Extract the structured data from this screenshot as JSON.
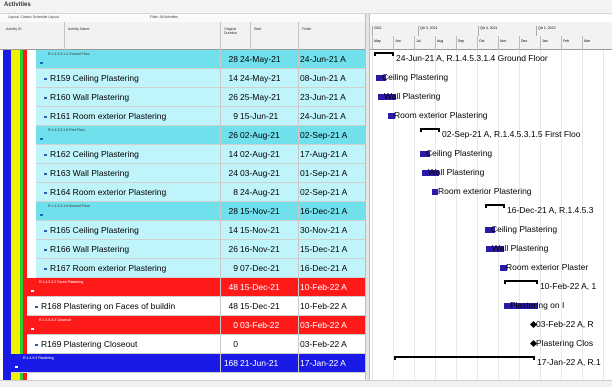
{
  "window": {
    "title": "Activities"
  },
  "toolbar": {
    "left": "Layout: Classic Schedule Layout",
    "filter": "Filter: All Activities"
  },
  "columns": {
    "activity_id": "Activity ID",
    "activity_name": "Activity Name",
    "original_duration": "Original Duration",
    "start": "Start",
    "finish": "Finish"
  },
  "timescale": {
    "years": [
      "2021",
      "Qtr 3, 2021",
      "Qtr 4, 2021",
      "Qtr 1, 2022"
    ],
    "months": [
      "May",
      "Jun",
      "Jul",
      "Aug",
      "Sep",
      "Oct",
      "Nov",
      "Dec",
      "Jan",
      "Feb",
      "Mar"
    ]
  },
  "rows": [
    {
      "type": "wbs",
      "color": "#70e0ec",
      "code": "R.1.4.5.3.1.4 Ground Floor",
      "name": "",
      "dur": "28",
      "start": "24-May-21 A",
      "finish": "24-Jun-21 A"
    },
    {
      "type": "task",
      "color": "#bff4fa",
      "code": "",
      "name": "R159  Ceiling Plastering",
      "dur": "14",
      "start": "24-May-21 A",
      "finish": "08-Jun-21 A"
    },
    {
      "type": "task",
      "color": "#bff4fa",
      "code": "",
      "name": "R160  Wall Plastering",
      "dur": "26",
      "start": "25-May-21 A",
      "finish": "23-Jun-21 A"
    },
    {
      "type": "task",
      "color": "#bff4fa",
      "code": "",
      "name": "R161  Room exterior Plastering",
      "dur": "9",
      "start": "15-Jun-21 A",
      "finish": "24-Jun-21 A"
    },
    {
      "type": "wbs",
      "color": "#70e0ec",
      "code": "R.1.4.5.3.1.5 First Floor",
      "name": "",
      "dur": "26",
      "start": "02-Aug-21 A",
      "finish": "02-Sep-21 A"
    },
    {
      "type": "task",
      "color": "#bff4fa",
      "code": "",
      "name": "R162  Ceiling Plastering",
      "dur": "14",
      "start": "02-Aug-21 A",
      "finish": "17-Aug-21 A"
    },
    {
      "type": "task",
      "color": "#bff4fa",
      "code": "",
      "name": "R163  Wall Plastering",
      "dur": "24",
      "start": "03-Aug-21 A",
      "finish": "01-Sep-21 A"
    },
    {
      "type": "task",
      "color": "#bff4fa",
      "code": "",
      "name": "R164  Room exterior Plastering",
      "dur": "8",
      "start": "24-Aug-21 A",
      "finish": "02-Sep-21 A"
    },
    {
      "type": "wbs",
      "color": "#70e0ec",
      "code": "R.1.4.5.3.1.6 Second Floor",
      "name": "",
      "dur": "28",
      "start": "15-Nov-21 A",
      "finish": "16-Dec-21 A"
    },
    {
      "type": "task",
      "color": "#bff4fa",
      "code": "",
      "name": "R165  Ceiling Plastering",
      "dur": "14",
      "start": "15-Nov-21 A",
      "finish": "30-Nov-21 A"
    },
    {
      "type": "task",
      "color": "#bff4fa",
      "code": "",
      "name": "R166  Wall Plastering",
      "dur": "26",
      "start": "16-Nov-21 A",
      "finish": "15-Dec-21 A"
    },
    {
      "type": "task",
      "color": "#bff4fa",
      "code": "",
      "name": "R167  Room exterior Plastering",
      "dur": "9",
      "start": "07-Dec-21 A",
      "finish": "16-Dec-21 A"
    },
    {
      "type": "wbs2",
      "color": "#ff1a1a",
      "code": "R.1.4.5.3.2 Faces Plastering",
      "name": "",
      "dur": "48",
      "start": "15-Dec-21 A",
      "finish": "10-Feb-22 A"
    },
    {
      "type": "task",
      "color": "#ffffff",
      "code": "",
      "name": "R168  Plastering on Faces of buildin",
      "dur": "48",
      "start": "15-Dec-21 A",
      "finish": "10-Feb-22 A"
    },
    {
      "type": "wbs2",
      "color": "#ff1a1a",
      "code": "R.1.4.5.3.3 Closeout",
      "name": "",
      "dur": "0",
      "start": "03-Feb-22 A",
      "finish": "03-Feb-22 A"
    },
    {
      "type": "task",
      "color": "#ffffff",
      "code": "",
      "name": "R169  Plastering Closeout",
      "dur": "0",
      "start": "",
      "finish": "03-Feb-22 A"
    },
    {
      "type": "wbs3",
      "color": "#1a1ae6",
      "code": "R.1.4.5.3 Plastering",
      "name": "",
      "dur": "168",
      "start": "21-Jun-21 A",
      "finish": "17-Jan-22 A"
    }
  ],
  "gantt_labels": [
    "24-Jun-21 A, R.1.4.5.3.1.4  Ground Floor",
    "Ceiling Plastering",
    "Wall Plastering",
    "Room exterior Plastering",
    "02-Sep-21 A, R.1.4.5.3.1.5  First Floo",
    "Ceiling Plastering",
    "Wall Plastering",
    "Room exterior Plastering",
    "16-Dec-21 A, R.1.4.5.3",
    "Ceiling Plastering",
    "Wall Plastering",
    "Room exterior Plaster",
    "10-Feb-22 A, 1",
    "Plastering on I",
    "03-Feb-22 A, R",
    "Plastering Clos",
    "17-Jan-22 A, R.1"
  ],
  "colors": {
    "wbs_cyan": "#70e0ec",
    "task_cyan": "#bff4fa",
    "wbs_red": "#ff1a1a",
    "wbs_blue": "#1a1ae6",
    "band_blue": "#1a1ae6",
    "band_yellow": "#f0f000",
    "band_green": "#2ecc2e",
    "bar_actual": "#2a1aa8"
  }
}
